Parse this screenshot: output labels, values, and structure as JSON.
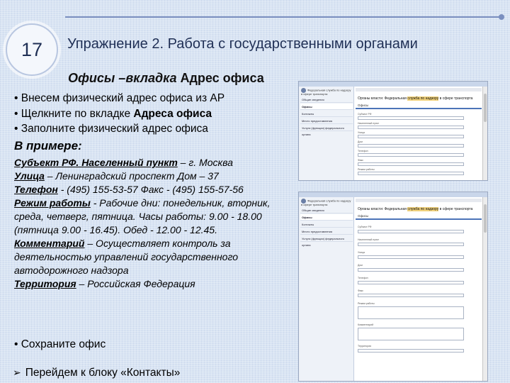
{
  "slide": {
    "number": "17",
    "title": "Упражнение 2. Работа с государственными органами",
    "subtitle_italic": "Офисы –вкладка",
    "subtitle_plain": " Адрес офиса"
  },
  "bullets": {
    "b1": "• Внесем физический адрес офиса из АР",
    "b2_prefix": "• Щелкните по вкладке ",
    "b2_bold": "Адреса офиса",
    "b3": "• Заполните физический адрес офиса"
  },
  "example": {
    "heading": "В примере:",
    "subject_label": "Субъект РФ. Населенный пункт",
    "subject_value": " – г. Москва",
    "street_label": "Улица",
    "street_value": " – Ленинградский проспект  Дом – 37",
    "phone_label": "Телефон",
    "phone_value": " - (495) 155-53-57  Факс - (495) 155-57-56",
    "hours_label": "Режим работы",
    "hours_value": " - Рабочие дни: понедельник, вторник, среда, четверг, пятница. Часы работы: 9.00 - 18.00 (пятница 9.00 - 16.45). Обед - 12.00 - 12.45.",
    "comment_label": "Комментарий",
    "comment_value": " – Осуществляет контроль за деятельностью управлений государственного автодорожного надзора",
    "territory_label": "Территория",
    "territory_value": " – Российская Федерация"
  },
  "footer": {
    "save": "• Сохраните офис",
    "next_arrow": "➢",
    "next": "Перейдем к блоку «Контакты»"
  },
  "screens": {
    "logo_text": "Федеральная служба по надзору в сфере транспорта",
    "nav_items": [
      "Общие сведения",
      "Офисы",
      "Контакты",
      "Место предоставления",
      "Услуги (функции) федерального органа"
    ],
    "title_pre": "Органы власти: Федеральная ",
    "title_hl": "служба по надзору",
    "title_post": " в сфере транспорта",
    "tab": "Офисы",
    "fields": [
      "Субъект РФ",
      "Населенный пункт",
      "Улица",
      "Дом",
      "Телефон",
      "Факс",
      "Режим работы",
      "Комментарий",
      "Территория"
    ]
  }
}
